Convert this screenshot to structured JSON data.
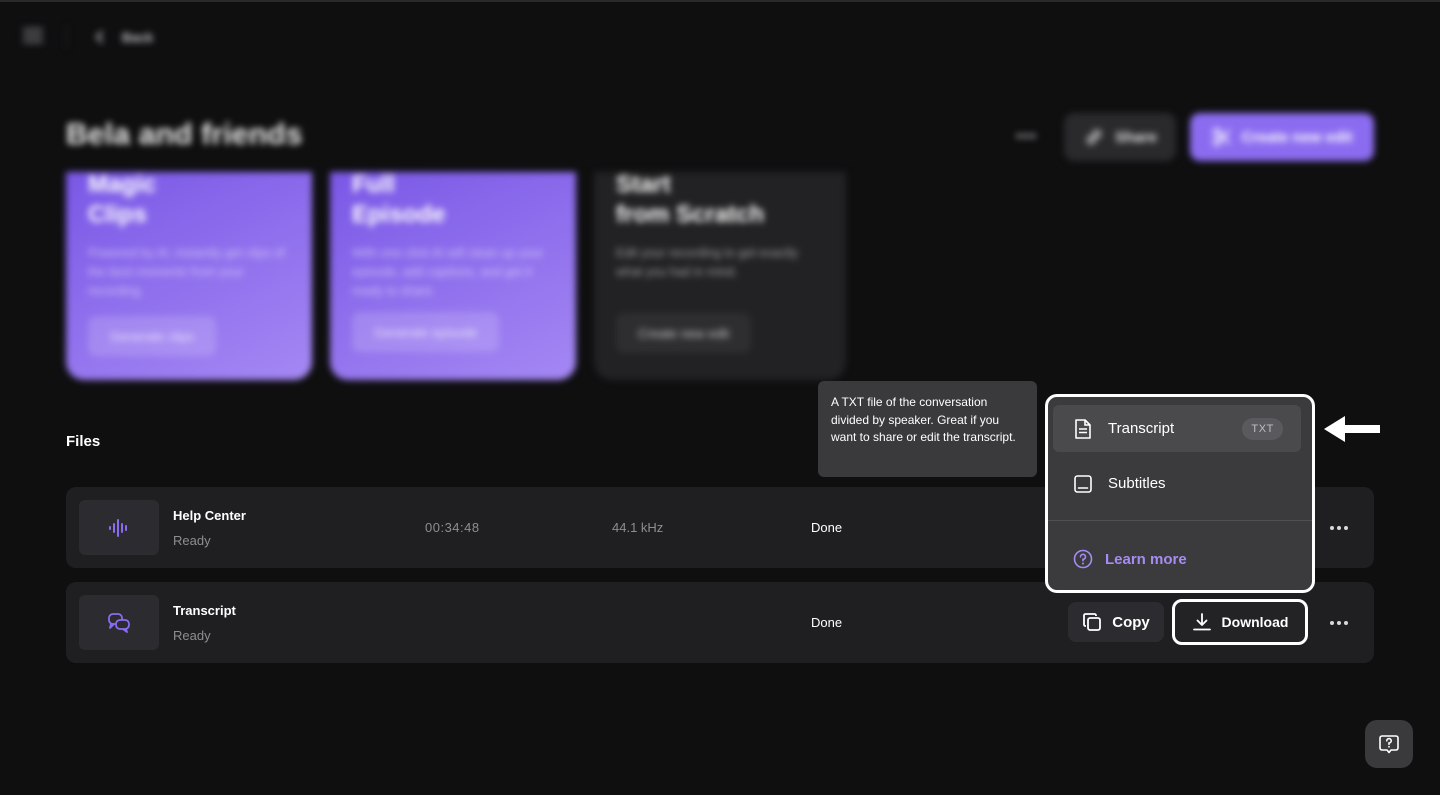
{
  "nav": {
    "back_label": "Back"
  },
  "page": {
    "title": "Bela and friends"
  },
  "header": {
    "share_label": "Share",
    "create_label": "Create new edit"
  },
  "cards": [
    {
      "title": "Magic\nClips",
      "desc": "Powered by AI, instantly get clips of the best moments from your recording.",
      "button": "Generate clips"
    },
    {
      "title": "Full\nEpisode",
      "desc": "With one click AI will clean up your episode, add captions, and get it ready to share.",
      "button": "Generate episode"
    },
    {
      "title": "Start\nfrom Scratch",
      "desc": "Edit your recording to get exactly what you had in mind.",
      "button": "Create new edit"
    }
  ],
  "files": {
    "title": "Files",
    "rows": [
      {
        "name": "Help Center",
        "sub": "Ready",
        "duration": "00:34:48",
        "rate": "44.1 kHz",
        "status": "Done"
      },
      {
        "name": "Transcript",
        "sub": "Ready",
        "status": "Done",
        "copy_label": "Copy",
        "download_label": "Download"
      }
    ]
  },
  "tooltip": {
    "text": "A TXT file of the conversation divided by speaker. Great if you want to share or edit the transcript."
  },
  "dropdown": {
    "items": [
      {
        "label": "Transcript",
        "badge": "TXT"
      },
      {
        "label": "Subtitles"
      }
    ],
    "learn_more": "Learn more"
  },
  "colors": {
    "accent": "#8b6cf0",
    "link": "#a48cf2",
    "background": "#0f0f10"
  },
  "icons": [
    "menu-icon",
    "chevron-left-icon",
    "more-icon",
    "link-icon",
    "scissors-icon",
    "audio-wave-icon",
    "chat-icon",
    "copy-icon",
    "download-icon",
    "document-icon",
    "subtitles-icon",
    "question-circle-icon",
    "arrow-left-icon",
    "help-icon"
  ]
}
